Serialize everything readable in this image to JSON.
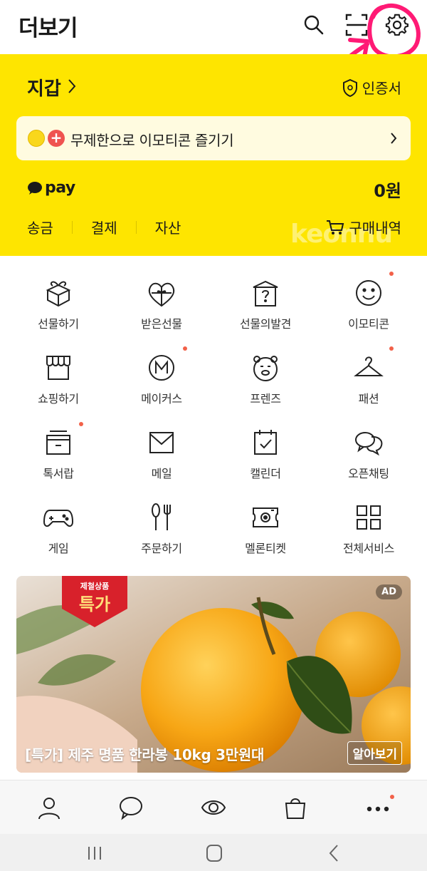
{
  "header": {
    "title": "더보기"
  },
  "wallet": {
    "title": "지갑",
    "certificate_label": "인증서",
    "promo_text": "무제한으로 이모티콘 즐기기",
    "pay_label": "pay",
    "balance": "0원",
    "links": [
      "송금",
      "결제",
      "자산"
    ],
    "purchase_label": "구매내역",
    "watermark": "keonnu"
  },
  "services": [
    {
      "label": "선물하기",
      "icon": "gift-box-icon",
      "dot": false
    },
    {
      "label": "받은선물",
      "icon": "heart-gift-icon",
      "dot": false
    },
    {
      "label": "선물의발견",
      "icon": "mystery-gift-icon",
      "dot": false
    },
    {
      "label": "이모티콘",
      "icon": "smile-icon",
      "dot": true
    },
    {
      "label": "쇼핑하기",
      "icon": "store-icon",
      "dot": false
    },
    {
      "label": "메이커스",
      "icon": "makers-m-icon",
      "dot": true
    },
    {
      "label": "프렌즈",
      "icon": "friends-bear-icon",
      "dot": false
    },
    {
      "label": "패션",
      "icon": "hanger-icon",
      "dot": true
    },
    {
      "label": "톡서랍",
      "icon": "drawer-icon",
      "dot": true
    },
    {
      "label": "메일",
      "icon": "mail-icon",
      "dot": false
    },
    {
      "label": "캘린더",
      "icon": "calendar-icon",
      "dot": false
    },
    {
      "label": "오픈채팅",
      "icon": "open-chat-icon",
      "dot": false
    },
    {
      "label": "게임",
      "icon": "gamepad-icon",
      "dot": false
    },
    {
      "label": "주문하기",
      "icon": "fork-spoon-icon",
      "dot": false
    },
    {
      "label": "멜론티켓",
      "icon": "ticket-icon",
      "dot": false
    },
    {
      "label": "전체서비스",
      "icon": "all-services-icon",
      "dot": false
    }
  ],
  "ad": {
    "badge": "AD",
    "ribbon_top": "제철상품",
    "ribbon_main": "특가",
    "text": "[특가] 제주 명품 한라봉 10kg 3만원대",
    "button": "알아보기"
  },
  "tabs": [
    "person-icon",
    "chat-bubble-icon",
    "eye-view-icon",
    "shopping-bag-icon",
    "more-dots-icon"
  ],
  "colors": {
    "kakao_yellow": "#fee500",
    "annotation_pink": "#ff1a75",
    "notify_dot": "#f26149"
  }
}
